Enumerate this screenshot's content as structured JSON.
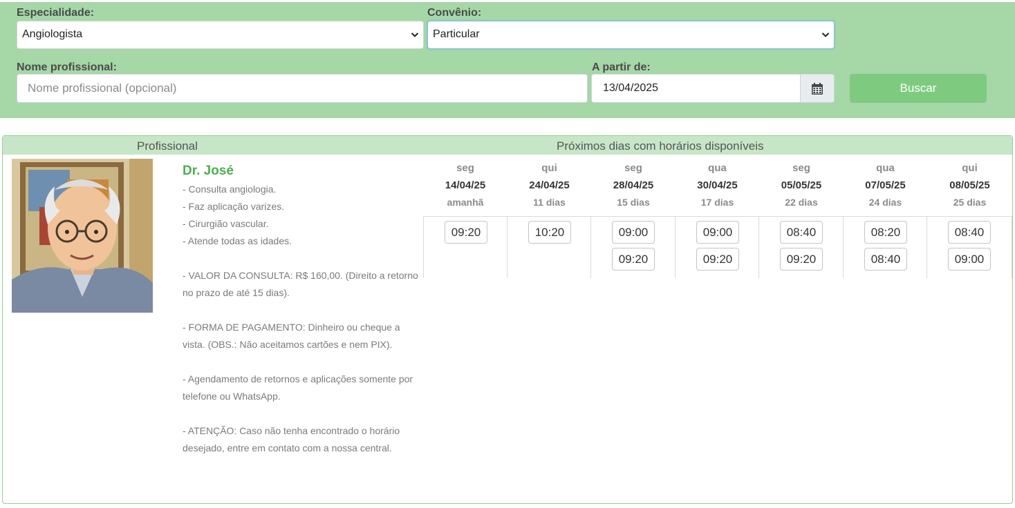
{
  "filters": {
    "especialidade_label": "Especialidade:",
    "especialidade_value": "Angiologista",
    "convenio_label": "Convênio:",
    "convenio_value": "Particular",
    "nome_label": "Nome profissional:",
    "nome_placeholder": "Nome profissional (opcional)",
    "data_label": "A partir de:",
    "data_value": "13/04/2025",
    "buscar_label": "Buscar"
  },
  "results": {
    "col_profissional": "Profissional",
    "col_dias": "Próximos dias com horários disponíveis"
  },
  "doctor": {
    "name": "Dr. José",
    "lines": [
      "- Consulta angiologia.",
      "- Faz aplicação varizes.",
      "- Cirurgião vascular.",
      "- Atende todas as idades.",
      "",
      "- VALOR DA CONSULTA: R$ 160,00. (Direito a retorno no prazo de até 15 dias).",
      "",
      "- FORMA DE PAGAMENTO: Dinheiro ou cheque a vista. (OBS.: Não aceitamos cartões e nem PIX).",
      "",
      "- Agendamento de retornos e aplicações somente por telefone ou WhatsApp.",
      "",
      "- ATENÇÃO: Caso não tenha encontrado o horário desejado, entre em contato com a nossa central."
    ]
  },
  "days": [
    {
      "dow": "seg",
      "date": "14/04/25",
      "rel": "amanhã",
      "slots": [
        "09:20"
      ]
    },
    {
      "dow": "qui",
      "date": "24/04/25",
      "rel": "11 dias",
      "slots": [
        "10:20"
      ]
    },
    {
      "dow": "seg",
      "date": "28/04/25",
      "rel": "15 dias",
      "slots": [
        "09:00",
        "09:20"
      ]
    },
    {
      "dow": "qua",
      "date": "30/04/25",
      "rel": "17 dias",
      "slots": [
        "09:00",
        "09:20"
      ]
    },
    {
      "dow": "seg",
      "date": "05/05/25",
      "rel": "22 dias",
      "slots": [
        "08:40",
        "09:20"
      ]
    },
    {
      "dow": "qua",
      "date": "07/05/25",
      "rel": "24 dias",
      "slots": [
        "08:20",
        "08:40"
      ]
    },
    {
      "dow": "qui",
      "date": "08/05/25",
      "rel": "25 dias",
      "slots": [
        "08:40",
        "09:00"
      ]
    }
  ]
}
